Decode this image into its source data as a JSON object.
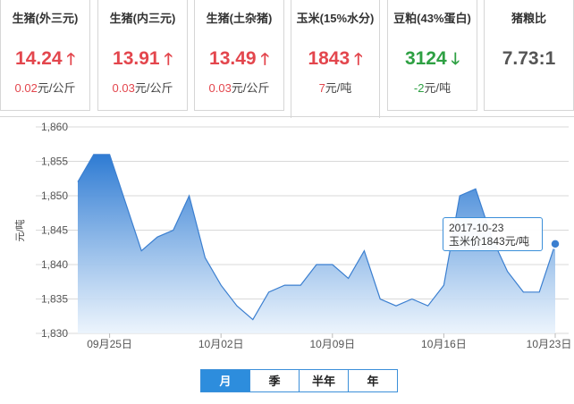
{
  "cards": [
    {
      "name": "生猪(外三元)",
      "price": "14.24",
      "direction": "up",
      "change": "0.02",
      "unit": "元/公斤"
    },
    {
      "name": "生猪(内三元)",
      "price": "13.91",
      "direction": "up",
      "change": "0.03",
      "unit": "元/公斤"
    },
    {
      "name": "生猪(土杂猪)",
      "price": "13.49",
      "direction": "up",
      "change": "0.03",
      "unit": "元/公斤"
    },
    {
      "name": "玉米(15%水分)",
      "price": "1843",
      "direction": "up",
      "change": "7",
      "unit": "元/吨"
    },
    {
      "name": "豆粕(43%蛋白)",
      "price": "3124",
      "direction": "down",
      "change": "-2",
      "unit": "元/吨"
    },
    {
      "name": "猪粮比",
      "price": "7.73:1",
      "direction": "none",
      "change": "",
      "unit": ""
    }
  ],
  "arrows": {
    "up": "🡑",
    "down": "🡓"
  },
  "colors": {
    "up": "#e3464d",
    "down": "#2ea043",
    "line": "#3b7fd0",
    "fill_top": "#2e7bd3",
    "fill_bottom": "#eaf3fc"
  },
  "tooltip": {
    "date": "2017-10-23",
    "text": "玉米价1843元/吨"
  },
  "ranges": [
    "月",
    "季",
    "半年",
    "年"
  ],
  "active_range": "月",
  "chart_data": {
    "type": "area",
    "ylabel": "元/吨",
    "ylim": [
      1830,
      1860
    ],
    "yticks": [
      1830,
      1835,
      1840,
      1845,
      1850,
      1855,
      1860
    ],
    "xtick_labels": [
      "09月25日",
      "10月02日",
      "10月09日",
      "10月16日",
      "10月23日"
    ],
    "xtick_index": [
      2,
      9,
      16,
      23,
      30
    ],
    "x": [
      "09-23",
      "09-24",
      "09-25",
      "09-26",
      "09-27",
      "09-28",
      "09-29",
      "09-30",
      "10-01",
      "10-02",
      "10-03",
      "10-04",
      "10-05",
      "10-06",
      "10-07",
      "10-08",
      "10-09",
      "10-10",
      "10-11",
      "10-12",
      "10-13",
      "10-14",
      "10-15",
      "10-16",
      "10-17",
      "10-18",
      "10-19",
      "10-20",
      "10-21",
      "10-22",
      "10-23"
    ],
    "values": [
      1852,
      1856,
      1856,
      1849,
      1842,
      1844,
      1845,
      1850,
      1841,
      1837,
      1834,
      1832,
      1836,
      1837,
      1837,
      1840,
      1840,
      1838,
      1842,
      1835,
      1834,
      1835,
      1834,
      1837,
      1850,
      1851,
      1844,
      1839,
      1836,
      1836,
      1843
    ],
    "grid": true,
    "highlight_index": 30
  }
}
